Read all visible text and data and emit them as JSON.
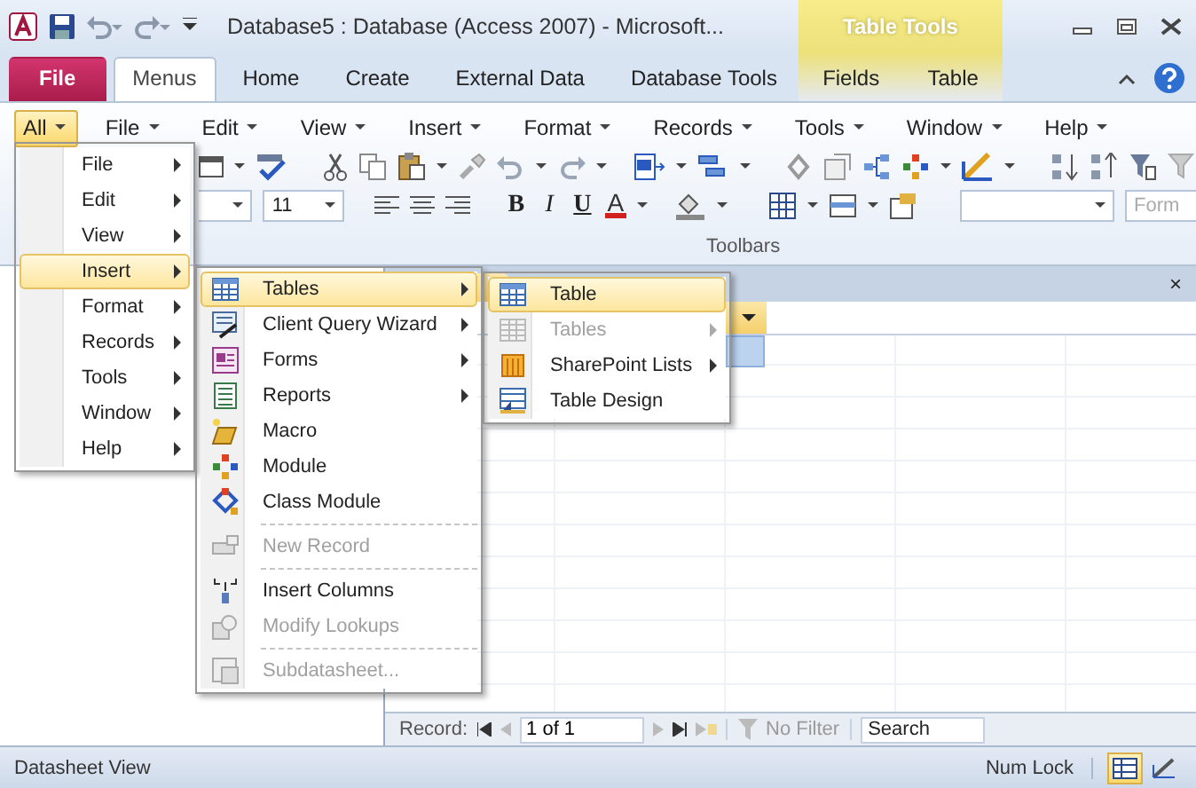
{
  "window": {
    "title": "Database5 : Database (Access 2007)  -  Microsoft...",
    "contextual_title": "Table Tools"
  },
  "ribbon_tabs": [
    {
      "label": "File",
      "kind": "file",
      "selected": false
    },
    {
      "label": "Menus",
      "kind": "tab",
      "selected": true
    },
    {
      "label": "Home",
      "kind": "tab",
      "selected": false
    },
    {
      "label": "Create",
      "kind": "tab",
      "selected": false
    },
    {
      "label": "External Data",
      "kind": "tab",
      "selected": false
    },
    {
      "label": "Database Tools",
      "kind": "tab",
      "selected": false
    },
    {
      "label": "Fields",
      "kind": "contextual",
      "selected": false
    },
    {
      "label": "Table",
      "kind": "contextual",
      "selected": false
    }
  ],
  "menu_bar": [
    {
      "label": "All",
      "selected": true
    },
    {
      "label": "File",
      "selected": false
    },
    {
      "label": "Edit",
      "selected": false
    },
    {
      "label": "View",
      "selected": false
    },
    {
      "label": "Insert",
      "selected": false
    },
    {
      "label": "Format",
      "selected": false
    },
    {
      "label": "Records",
      "selected": false
    },
    {
      "label": "Tools",
      "selected": false
    },
    {
      "label": "Window",
      "selected": false
    },
    {
      "label": "Help",
      "selected": false
    }
  ],
  "toolbar": {
    "font_size": "11",
    "format_buttons": [
      "B",
      "I",
      "U",
      "A"
    ],
    "form_field_placeholder": "Form",
    "group_label": "Toolbars"
  },
  "menus": [
    {
      "items": [
        {
          "label": "File",
          "selected": false,
          "disabled": false,
          "submenu": true
        },
        {
          "label": "Edit",
          "selected": false,
          "disabled": false,
          "submenu": true
        },
        {
          "label": "View",
          "selected": false,
          "disabled": false,
          "submenu": true
        },
        {
          "label": "Insert",
          "selected": true,
          "disabled": false,
          "submenu": true
        },
        {
          "label": "Format",
          "selected": false,
          "disabled": false,
          "submenu": true
        },
        {
          "label": "Records",
          "selected": false,
          "disabled": false,
          "submenu": true
        },
        {
          "label": "Tools",
          "selected": false,
          "disabled": false,
          "submenu": true
        },
        {
          "label": "Window",
          "selected": false,
          "disabled": false,
          "submenu": true
        },
        {
          "label": "Help",
          "selected": false,
          "disabled": false,
          "submenu": true
        }
      ]
    },
    {
      "items": [
        {
          "label": "Tables",
          "selected": true,
          "disabled": false,
          "submenu": true,
          "separator_before": false
        },
        {
          "label": "Client Query Wizard",
          "selected": false,
          "disabled": false,
          "submenu": true,
          "separator_before": false
        },
        {
          "label": "Forms",
          "selected": false,
          "disabled": false,
          "submenu": true,
          "separator_before": false
        },
        {
          "label": "Reports",
          "selected": false,
          "disabled": false,
          "submenu": true,
          "separator_before": false
        },
        {
          "label": "Macro",
          "selected": false,
          "disabled": false,
          "submenu": false,
          "separator_before": false
        },
        {
          "label": "Module",
          "selected": false,
          "disabled": false,
          "submenu": false,
          "separator_before": false
        },
        {
          "label": "Class Module",
          "selected": false,
          "disabled": false,
          "submenu": false,
          "separator_before": false
        },
        {
          "label": "New Record",
          "selected": false,
          "disabled": true,
          "submenu": false,
          "separator_before": true
        },
        {
          "label": "Insert Columns",
          "selected": false,
          "disabled": false,
          "submenu": false,
          "separator_before": true
        },
        {
          "label": "Modify Lookups",
          "selected": false,
          "disabled": true,
          "submenu": false,
          "separator_before": false
        },
        {
          "label": "Subdatasheet...",
          "selected": false,
          "disabled": true,
          "submenu": false,
          "separator_before": true
        }
      ]
    },
    {
      "items": [
        {
          "label": "Table",
          "selected": true,
          "disabled": false,
          "submenu": false
        },
        {
          "label": "Tables",
          "selected": false,
          "disabled": true,
          "submenu": true
        },
        {
          "label": "SharePoint Lists",
          "selected": false,
          "disabled": false,
          "submenu": true
        },
        {
          "label": "Table Design",
          "selected": false,
          "disabled": false,
          "submenu": false
        }
      ]
    }
  ],
  "document_tabs": {
    "close_glyph": "×"
  },
  "record_nav": {
    "label": "Record:",
    "position": "1 of 1",
    "filter": "No Filter",
    "search_placeholder": "Search"
  },
  "status_bar": {
    "text": "Datasheet View",
    "indicator": "Num Lock",
    "view_buttons": [
      {
        "selected": true
      },
      {
        "selected": false
      }
    ]
  }
}
